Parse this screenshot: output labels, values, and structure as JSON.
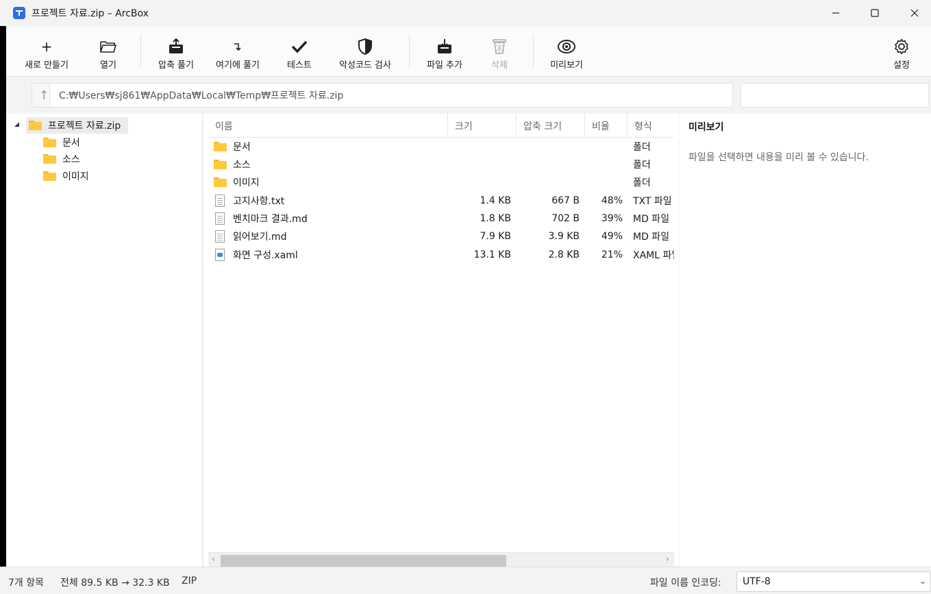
{
  "window": {
    "title": "프로젝트 자료.zip – ArcBox"
  },
  "toolbar": {
    "new": "새로 만들기",
    "open": "열기",
    "extract": "압축 풀기",
    "extract_here": "여기에 풀기",
    "test": "테스트",
    "malware_scan": "악성코드 검사",
    "add_files": "파일 추가",
    "delete": "삭제",
    "preview": "미리보기",
    "settings": "설정"
  },
  "address": {
    "path": "C:₩Users₩sj861₩AppData₩Local₩Temp₩프로젝트 자료.zip",
    "search_value": ""
  },
  "tree": {
    "root": "프로젝트 자료.zip",
    "children": [
      "문서",
      "소스",
      "이미지"
    ]
  },
  "list": {
    "columns": {
      "name": "이름",
      "size": "크기",
      "packed": "압축 크기",
      "ratio": "비율",
      "type": "형식"
    },
    "rows": [
      {
        "icon": "folder-icon",
        "name": "문서",
        "size": "",
        "packed": "",
        "ratio": "",
        "type": "폴더"
      },
      {
        "icon": "folder-icon",
        "name": "소스",
        "size": "",
        "packed": "",
        "ratio": "",
        "type": "폴더"
      },
      {
        "icon": "folder-icon",
        "name": "이미지",
        "size": "",
        "packed": "",
        "ratio": "",
        "type": "폴더"
      },
      {
        "icon": "text-file-icon",
        "name": "고지사항.txt",
        "size": "1.4 KB",
        "packed": "667 B",
        "ratio": "48%",
        "type": "TXT 파일"
      },
      {
        "icon": "text-file-icon",
        "name": "벤치마크 결과.md",
        "size": "1.8 KB",
        "packed": "702 B",
        "ratio": "39%",
        "type": "MD 파일"
      },
      {
        "icon": "text-file-icon",
        "name": "읽어보기.md",
        "size": "7.9 KB",
        "packed": "3.9 KB",
        "ratio": "49%",
        "type": "MD 파일"
      },
      {
        "icon": "xaml-file-icon",
        "name": "화면 구성.xaml",
        "size": "13.1 KB",
        "packed": "2.8 KB",
        "ratio": "21%",
        "type": "XAML 파일"
      }
    ]
  },
  "preview": {
    "title": "미리보기",
    "message": "파일을 선택하면 내용을 미리 볼 수 있습니다."
  },
  "status": {
    "count": "7개 항목",
    "total": "전체 89.5 KB → 32.3 KB",
    "format": "ZIP",
    "encoding_label": "파일 이름 인코딩:",
    "encoding_value": "UTF-8"
  },
  "colors": {
    "accent": "#2f6fe0",
    "folder": "#ffc83d",
    "background": "#f3f3f3"
  }
}
